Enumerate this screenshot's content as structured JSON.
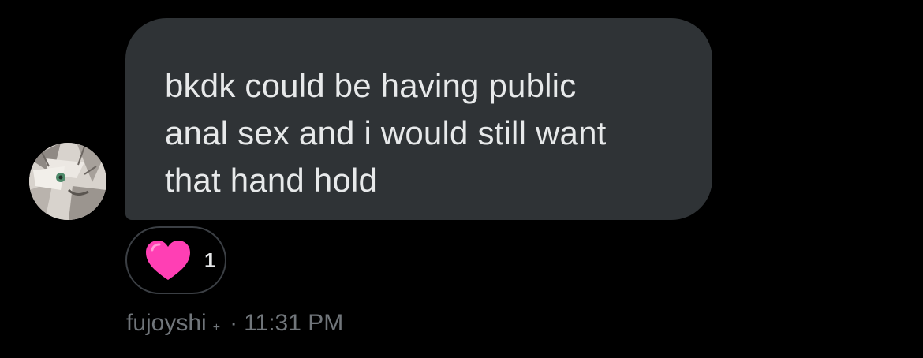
{
  "message": {
    "text": "bkdk could be having public\nanal sex and i would still want\nthat hand hold"
  },
  "reaction": {
    "emoji": "pink-heart-icon",
    "count": "1"
  },
  "meta": {
    "sender": "fujoyshi",
    "sender_suffix": "+",
    "separator": "·",
    "time": "11:31 PM"
  },
  "colors": {
    "background": "#000000",
    "bubble": "#2f3336",
    "text": "#e7e9ea",
    "muted": "#71767b",
    "heart": "#ff3fb4"
  }
}
